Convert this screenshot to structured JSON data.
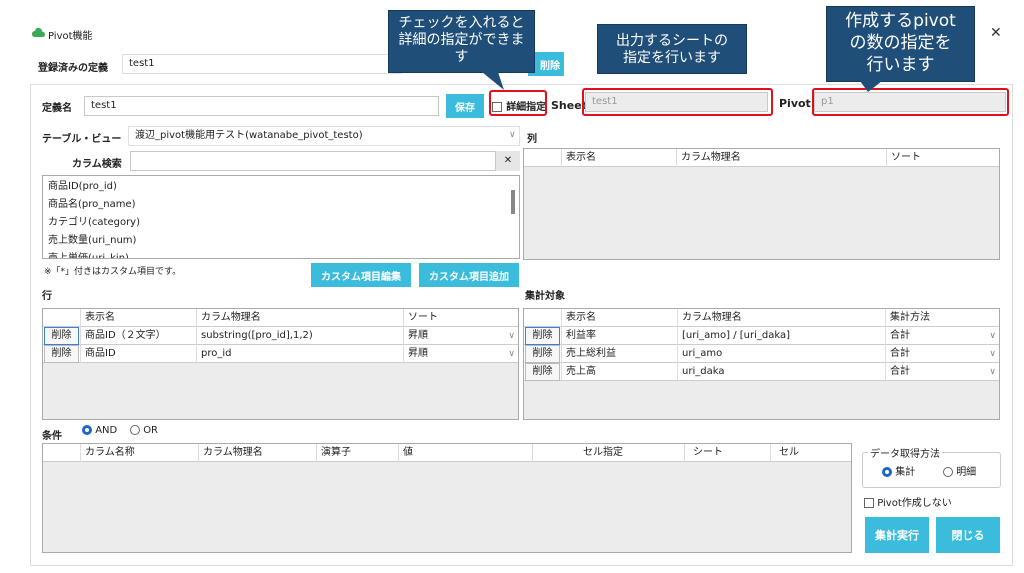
{
  "window": {
    "title": "Pivot機能",
    "close": "✕"
  },
  "registered": {
    "label": "登録済みの定義",
    "value": "test1",
    "button": "削除"
  },
  "definition": {
    "label": "定義名",
    "value": "test1",
    "save": "保存",
    "detail_label": "詳細指定",
    "sheet_label": "Sheet",
    "sheet_placeholder": "test1",
    "pivot_label": "Pivot",
    "pivot_placeholder": "p1"
  },
  "callouts": {
    "detail": [
      "チェックを入れると",
      "詳細の指定ができま",
      "す"
    ],
    "sheet": [
      "出力するシートの",
      "指定を行います"
    ],
    "pivot": [
      "作成するpivot",
      "の数の指定を",
      "行います"
    ]
  },
  "table_view": {
    "label": "テーブル・ビュー",
    "value": "渡辺_pivot機能用テスト(watanabe_pivot_testo)"
  },
  "column_search": {
    "label": "カラム検索",
    "value": "",
    "clear": "✕"
  },
  "column_list": [
    "商品ID(pro_id)",
    "商品名(pro_name)",
    "カテゴリ(category)",
    "売上数量(uri_num)",
    "売上単価(uri_kin)"
  ],
  "custom": {
    "note": "※「*」付きはカスタム項目です。",
    "edit": "カスタム項目編集",
    "add": "カスタム項目追加"
  },
  "col_section": {
    "label": "列",
    "headers": [
      "表示名",
      "カラム物理名",
      "ソート"
    ]
  },
  "row_section": {
    "label": "行",
    "headers": [
      "表示名",
      "カラム物理名",
      "ソート"
    ],
    "rows": [
      {
        "del": "削除",
        "name": "商品ID（２文字）",
        "phys": "substring([pro_id],1,2)",
        "sort": "昇順"
      },
      {
        "del": "削除",
        "name": "商品ID",
        "phys": "pro_id",
        "sort": "昇順"
      }
    ]
  },
  "agg_section": {
    "label": "集計対象",
    "headers": [
      "表示名",
      "カラム物理名",
      "集計方法"
    ],
    "rows": [
      {
        "del": "削除",
        "name": "利益率",
        "phys": "[uri_amo] / [uri_daka]",
        "method": "合計"
      },
      {
        "del": "削除",
        "name": "売上総利益",
        "phys": "uri_amo",
        "method": "合計"
      },
      {
        "del": "削除",
        "name": "売上高",
        "phys": "uri_daka",
        "method": "合計"
      }
    ]
  },
  "conditions": {
    "label": "条件",
    "and": "AND",
    "or": "OR",
    "headers": [
      "カラム名称",
      "カラム物理名",
      "演算子",
      "値",
      "セル指定",
      "シート",
      "セル"
    ]
  },
  "data_method": {
    "label": "データ取得方法",
    "agg": "集計",
    "detail": "明細"
  },
  "no_pivot": "Pivot作成しない",
  "run": "集計実行",
  "close": "閉じる"
}
